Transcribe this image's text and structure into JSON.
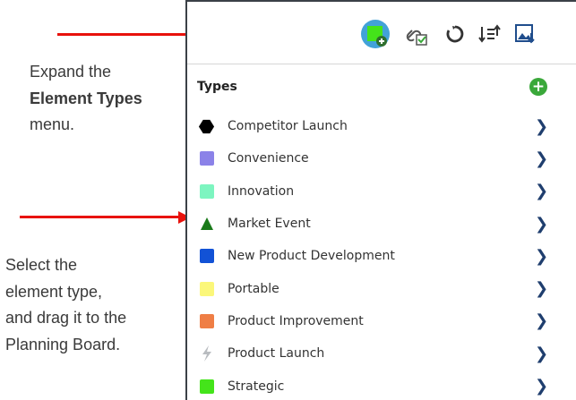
{
  "instructions": {
    "step1_line1": "Expand the",
    "step1_bold": "Element Types",
    "step1_line3": "menu.",
    "step2_line1": "Select the",
    "step2_line2": "element type,",
    "step2_line3": "and drag it to the",
    "step2_line4": "Planning Board."
  },
  "toolbar": {
    "buttons": [
      "add-element-type",
      "link-check",
      "refresh",
      "sort",
      "image-export"
    ]
  },
  "types": {
    "header": "Types",
    "items": [
      {
        "label": "Competitor Launch",
        "icon": "hexagon",
        "color": "#000000"
      },
      {
        "label": "Convenience",
        "icon": "square",
        "color": "#8b82e8"
      },
      {
        "label": "Innovation",
        "icon": "square",
        "color": "#7df5c0"
      },
      {
        "label": "Market Event",
        "icon": "triangle",
        "color": "#1a7a1a"
      },
      {
        "label": "New Product Development",
        "icon": "square",
        "color": "#1252d6"
      },
      {
        "label": "Portable",
        "icon": "square",
        "color": "#fbf77a"
      },
      {
        "label": "Product Improvement",
        "icon": "square",
        "color": "#ef7e45"
      },
      {
        "label": "Product Launch",
        "icon": "lightning",
        "color": "#b9bcc0"
      },
      {
        "label": "Strategic",
        "icon": "square",
        "color": "#44e41a"
      }
    ]
  },
  "colors": {
    "accent_green": "#3aa83a",
    "arrow_red": "#e8120c",
    "chevron": "#1f3e6e"
  }
}
